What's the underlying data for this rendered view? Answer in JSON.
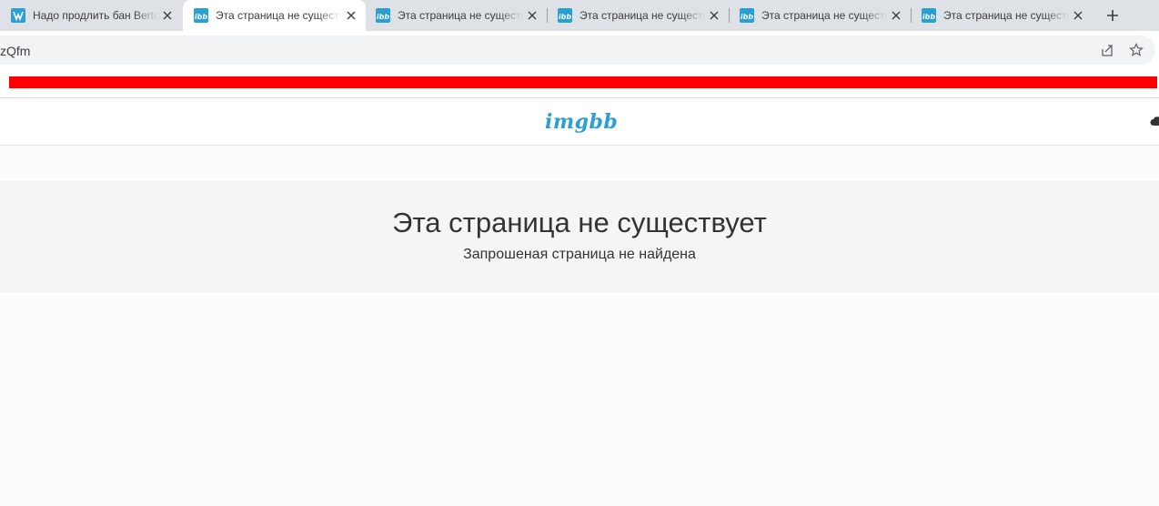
{
  "browser": {
    "tabs": [
      {
        "title": "Надо продлить бан Berto",
        "favicon": "wordpress-icon",
        "active": false
      },
      {
        "title": "Эта страница не существует",
        "favicon": "imgbb-icon",
        "active": true
      },
      {
        "title": "Эта страница не существует",
        "favicon": "imgbb-icon",
        "active": false
      },
      {
        "title": "Эта страница не существует",
        "favicon": "imgbb-icon",
        "active": false
      },
      {
        "title": "Эта страница не существует",
        "favicon": "imgbb-icon",
        "active": false
      },
      {
        "title": "Эта страница не существует",
        "favicon": "imgbb-icon",
        "active": false
      }
    ],
    "favicon_label": "ibb",
    "url": "zQfm",
    "colors": {
      "tabstrip": "#dee1e6",
      "favicon_bg": "#2a9fd6",
      "redaction": "#ff0000"
    }
  },
  "site": {
    "logo": "imgbb",
    "error_title": "Эта страница не существует",
    "error_subtitle": "Запрошеная страница не найдена"
  }
}
